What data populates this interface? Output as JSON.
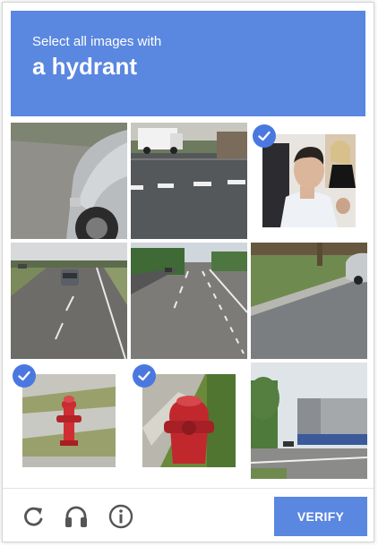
{
  "header": {
    "instruction": "Select all images with",
    "target": "a hydrant"
  },
  "tiles": [
    {
      "name": "tile-car-side",
      "selected": false
    },
    {
      "name": "tile-street-truck",
      "selected": false
    },
    {
      "name": "tile-people",
      "selected": true
    },
    {
      "name": "tile-highway",
      "selected": false
    },
    {
      "name": "tile-road",
      "selected": false
    },
    {
      "name": "tile-grass-curb",
      "selected": false
    },
    {
      "name": "tile-hydrant-sidewalk",
      "selected": true
    },
    {
      "name": "tile-hydrant-closeup",
      "selected": true
    },
    {
      "name": "tile-building-road",
      "selected": false
    }
  ],
  "footer": {
    "verify_label": "VERIFY",
    "icons": [
      "reload-icon",
      "audio-icon",
      "info-icon"
    ]
  },
  "colors": {
    "accent": "#5a87e0",
    "check": "#4a78e0"
  }
}
